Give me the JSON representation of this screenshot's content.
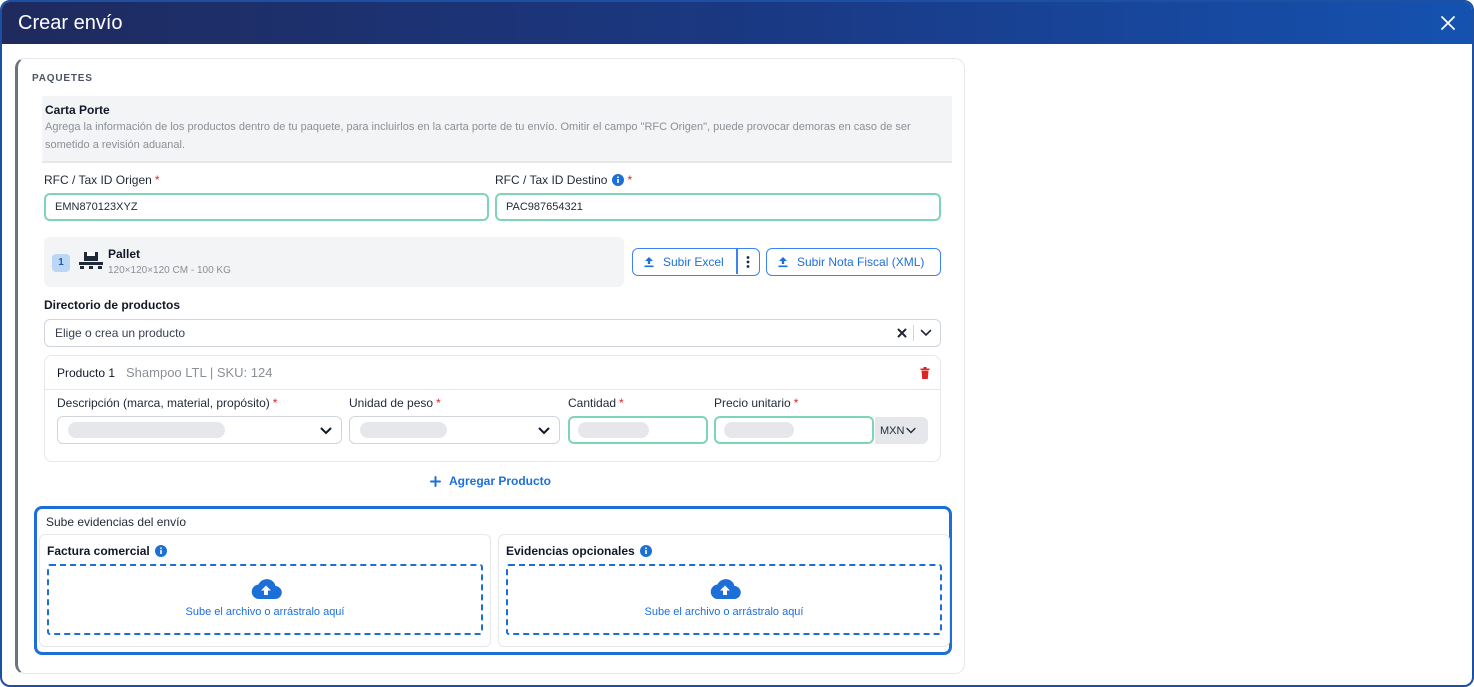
{
  "window": {
    "title": "Crear envío"
  },
  "packages": {
    "section_label": "PAQUETES",
    "info": {
      "title": "Carta Porte",
      "text": "Agrega la información de los productos dentro de tu paquete, para incluirlos en la carta porte de tu envío. Omitir el campo \"RFC Origen\", puede provocar demoras en caso de ser sometido a revisión aduanal."
    },
    "rfc_origin": {
      "label": "RFC / Tax ID Origen",
      "required": "*",
      "value": "EMN870123XYZ"
    },
    "rfc_dest": {
      "label": "RFC / Tax ID Destino",
      "required": "*",
      "value": "PAC987654321"
    },
    "pallet": {
      "index": "1",
      "name": "Pallet",
      "dims": "120×120×120 CM - 100 KG"
    },
    "buttons": {
      "upload_excel": "Subir Excel",
      "upload_xml": "Subir Nota Fiscal (XML)"
    },
    "directory": {
      "label": "Directorio de productos",
      "placeholder": "Elige o crea un producto"
    },
    "product": {
      "title": "Producto 1",
      "subtitle": "Shampoo LTL | SKU: 124",
      "desc_label": "Descripción (marca, material, propósito)",
      "weight_label": "Unidad de peso",
      "qty_label": "Cantidad",
      "price_label": "Precio unitario",
      "required": "*",
      "currency": "MXN"
    },
    "add_product": "Agregar Producto"
  },
  "evidence": {
    "title": "Sube evidencias del envío",
    "invoice": {
      "label": "Factura comercial",
      "dropzone": "Sube el archivo o arrástralo aquí"
    },
    "optional": {
      "label": "Evidencias opcionales",
      "dropzone": "Sube el archivo o arrástralo aquí"
    }
  },
  "colors": {
    "header_start": "#1f2a5e",
    "header_end": "#1552b0",
    "accent": "#1c6fd6",
    "valid_border": "#7fd4b5",
    "danger": "#dc2626"
  }
}
